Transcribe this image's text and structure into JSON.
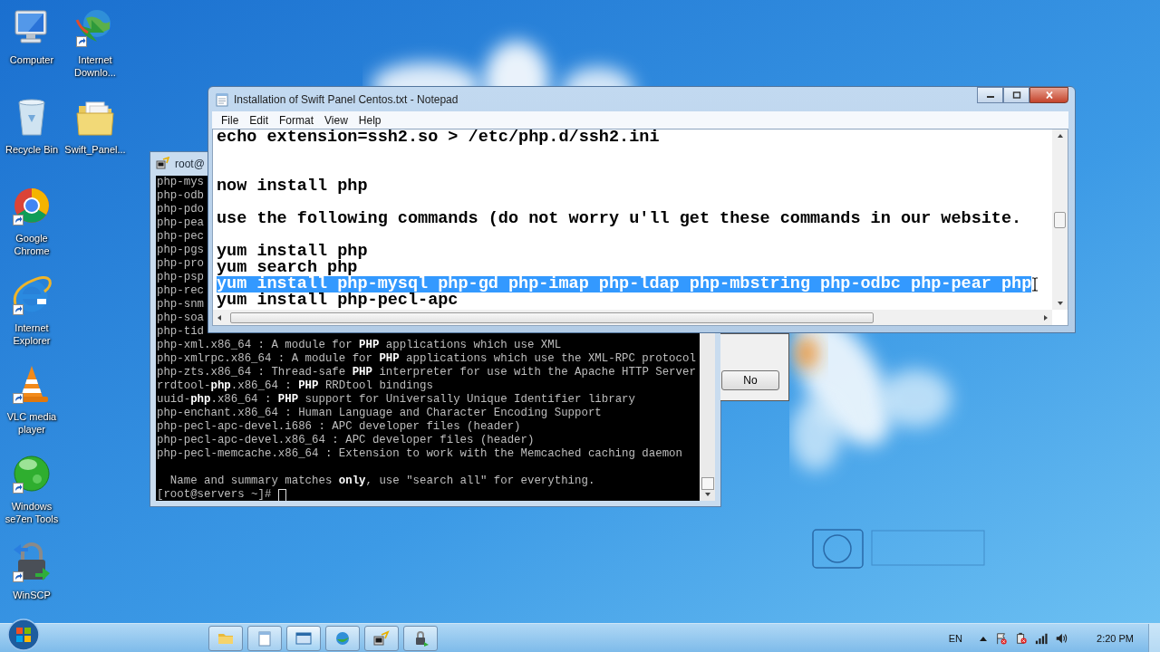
{
  "desktop_icons": [
    {
      "label": "Computer",
      "shortcut": false
    },
    {
      "label": "Internet Downlo...",
      "shortcut": true
    },
    {
      "label": "Recycle Bin",
      "shortcut": false
    },
    {
      "label": "Swift_Panel...",
      "shortcut": false
    },
    {
      "label": "Google Chrome",
      "shortcut": true
    },
    {
      "label": "Internet Explorer",
      "shortcut": true
    },
    {
      "label": "VLC media player",
      "shortcut": true
    },
    {
      "label": "Windows se7en Tools",
      "shortcut": true
    },
    {
      "label": "WinSCP",
      "shortcut": true
    }
  ],
  "terminal": {
    "title": "root@",
    "lines": [
      {
        "text": "php-mys"
      },
      {
        "text": "php-odb"
      },
      {
        "text": "php-pdo"
      },
      {
        "text": "php-pea"
      },
      {
        "text": "php-pec"
      },
      {
        "text": "php-pgs"
      },
      {
        "text": "php-pro"
      },
      {
        "text": "php-psp"
      },
      {
        "text": "php-rec"
      },
      {
        "text": "php-snm"
      },
      {
        "text": "php-soa"
      },
      {
        "text": "php-tid"
      },
      {
        "text": "php-xml.x86_64 : A module for **PHP** applications which use XML"
      },
      {
        "text": "php-xmlrpc.x86_64 : A module for **PHP** applications which use the XML-RPC protocol"
      },
      {
        "text": "php-zts.x86_64 : Thread-safe **PHP** interpreter for use with the Apache HTTP Server"
      },
      {
        "text": "rrdtool-**php**.x86_64 : **PHP** RRDtool bindings"
      },
      {
        "text": "uuid-**php**.x86_64 : **PHP** support for Universally Unique Identifier library"
      },
      {
        "text": "php-enchant.x86_64 : Human Language and Character Encoding Support"
      },
      {
        "text": "php-pecl-apc-devel.i686 : APC developer files (header)"
      },
      {
        "text": "php-pecl-apc-devel.x86_64 : APC developer files (header)"
      },
      {
        "text": "php-pecl-memcache.x86_64 : Extension to work with the Memcached caching daemon"
      },
      {
        "kind": "blank"
      },
      {
        "text": "  Name and summary matches **only**, use \"search all\" for everything."
      },
      {
        "kind": "prompt",
        "text": "[root@servers ~]#"
      }
    ]
  },
  "dialog": {
    "buttons": [
      "No"
    ]
  },
  "notepad": {
    "title": "Installation of Swift Panel Centos.txt - Notepad",
    "menu": [
      "File",
      "Edit",
      "Format",
      "View",
      "Help"
    ],
    "lines": [
      {
        "text": "echo extension=ssh2.so > /etc/php.d/ssh2.ini",
        "selected": false
      },
      {
        "kind": "blank"
      },
      {
        "kind": "blank"
      },
      {
        "text": "now install php",
        "selected": false
      },
      {
        "kind": "blank"
      },
      {
        "text": "use the following commands (do not worry u'll get these commands in our website.",
        "selected": false
      },
      {
        "kind": "blank"
      },
      {
        "text": "yum install php",
        "selected": false
      },
      {
        "text": "yum search php",
        "selected": false
      },
      {
        "text": "yum install php-mysql php-gd php-imap php-ldap php-mbstring php-odbc php-pear php",
        "selected": true
      },
      {
        "text": "yum install php-pecl-apc",
        "selected": false
      }
    ]
  },
  "taskbar": {
    "language": "EN",
    "clock": "2:20 PM"
  }
}
